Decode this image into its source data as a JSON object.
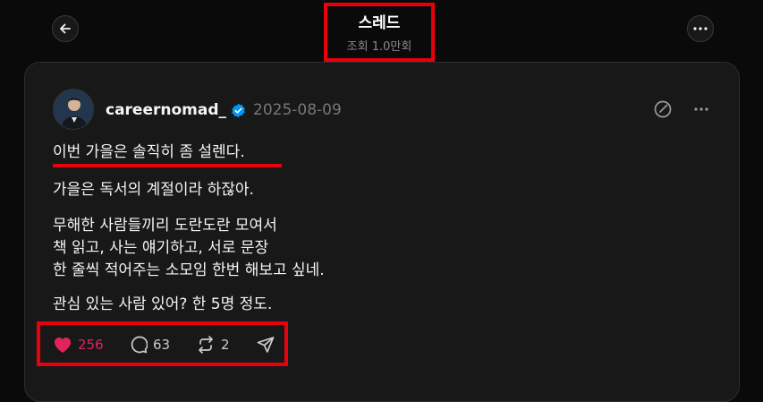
{
  "header": {
    "title": "스레드",
    "views": "조회 1.0만회"
  },
  "post": {
    "username": "careernomad_",
    "date": "2025-08-09",
    "paragraphs": {
      "p1": "이번 가을은 솔직히 좀 설렌다.",
      "p2": "가을은 독서의 계절이라 하잖아.",
      "p3_line1": "무해한 사람들끼리 도란도란 모여서",
      "p3_line2": "책 읽고, 사는 얘기하고, 서로 문장",
      "p3_line3": "한 줄씩 적어주는 소모임 한번 해보고 싶네.",
      "p4": "관심 있는 사람 있어? 한 5명 정도."
    },
    "actions": {
      "likes": "256",
      "comments": "63",
      "reposts": "2"
    }
  },
  "colors": {
    "accent_red": "#e8000b",
    "like_pink": "#e0245e",
    "verified_blue": "#0095f6"
  },
  "icons": [
    "back-arrow-icon",
    "more-icon",
    "verified-icon",
    "edit-icon",
    "heart-icon",
    "comment-icon",
    "repost-icon",
    "share-icon"
  ]
}
